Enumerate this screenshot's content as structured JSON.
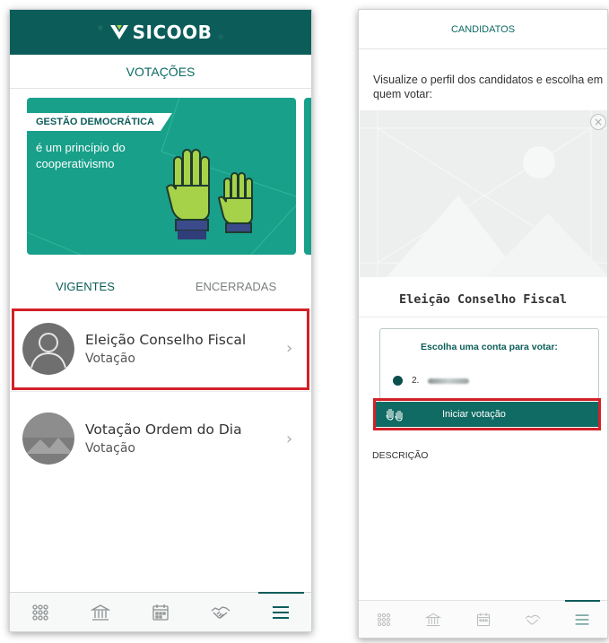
{
  "left": {
    "brand": "SICOOB",
    "title": "VOTAÇÕES",
    "banner": {
      "tag": "GESTÃO DEMOCRÁTICA",
      "text": "é um princípio do cooperativismo",
      "colors": {
        "background": "#18a08a",
        "hands_fill": "#a6d24a",
        "cuff": "#3b4a8a"
      }
    },
    "tabs": [
      {
        "label": "VIGENTES",
        "active": true
      },
      {
        "label": "ENCERRADAS",
        "active": false
      }
    ],
    "items": [
      {
        "title": "Eleição Conselho Fiscal",
        "subtitle": "Votação",
        "icon": "user-avatar-icon",
        "highlighted": true
      },
      {
        "title": "Votação Ordem do Dia",
        "subtitle": "Votação",
        "icon": "image-avatar-icon",
        "highlighted": false
      }
    ],
    "bottom_nav": [
      {
        "icon": "grid-icon"
      },
      {
        "icon": "bank-icon"
      },
      {
        "icon": "calendar-icon"
      },
      {
        "icon": "handshake-icon"
      },
      {
        "icon": "menu-icon",
        "active": true
      }
    ]
  },
  "right": {
    "header": "CANDIDATOS",
    "intro": "Visualize o perfil dos candidatos e escolha em quem votar:",
    "image_placeholder": "image-placeholder-icon",
    "candidate_name": "Eleição Conselho Fiscal",
    "account_prompt": "Escolha uma conta para votar:",
    "account_number": "2.",
    "start_button": "Iniciar votação",
    "description_label": "DESCRIÇÃO",
    "bottom_nav": [
      {
        "icon": "grid-icon"
      },
      {
        "icon": "bank-icon"
      },
      {
        "icon": "calendar-icon"
      },
      {
        "icon": "handshake-icon"
      },
      {
        "icon": "menu-icon",
        "active": true
      }
    ]
  },
  "colors": {
    "brand_dark": "#0c5d5a",
    "brand_teal": "#18a08a",
    "highlight": "#d32027"
  }
}
